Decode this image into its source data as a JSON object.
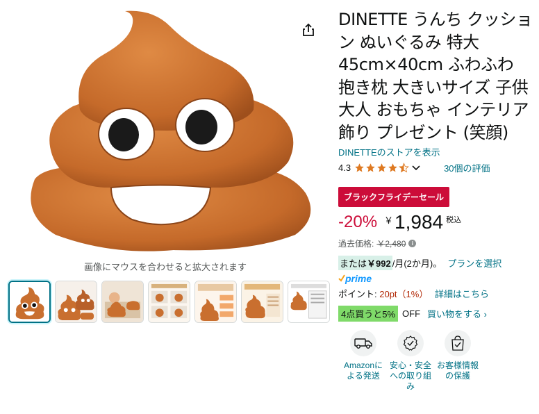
{
  "gallery": {
    "zoom_hint": "画像にマウスを合わせると拡大されます",
    "share_icon": "share-icon",
    "thumb_count": 7
  },
  "product": {
    "title": "DINETTE うんち クッション ぬいぐるみ 特大 45cm×40cm ふわふわ 抱き枕 大きいサイズ 子供 大人 おもちゃ インテリア 飾り プレゼント (笑顔)",
    "store_link": "DINETTEのストアを表示",
    "rating": "4.3",
    "rating_value": 4.3,
    "reviews_link": "30個の評価",
    "sale_badge": "ブラックフライデーセール",
    "discount": "-20%",
    "yen_symbol": "￥",
    "price": "1,984",
    "tax_label": "税込",
    "list_price_label": "過去価格:",
    "list_price": "￥2,480",
    "install_prefix": "または",
    "install_amount": "￥992",
    "install_suffix": "/月(2か月)。",
    "install_link": "プランを選択",
    "prime_label": "prime",
    "points_label": "ポイント: ",
    "points_value": "20pt（1%）",
    "points_link": "詳細はこちら",
    "bulk_chip": "4点買うと5%",
    "bulk_off": "OFF",
    "bulk_link": "買い物をする ›"
  },
  "features": [
    {
      "label": "Amazonによる発送",
      "icon": "truck-icon"
    },
    {
      "label": "安心・安全への取り組み",
      "icon": "shield-badge-icon"
    },
    {
      "label": "お客様情報の保護",
      "icon": "secure-bag-icon"
    }
  ],
  "colors": {
    "link": "#007185",
    "sale_red": "#cc0c39",
    "star": "#de7921",
    "poop_brown": "#c96f2f"
  }
}
